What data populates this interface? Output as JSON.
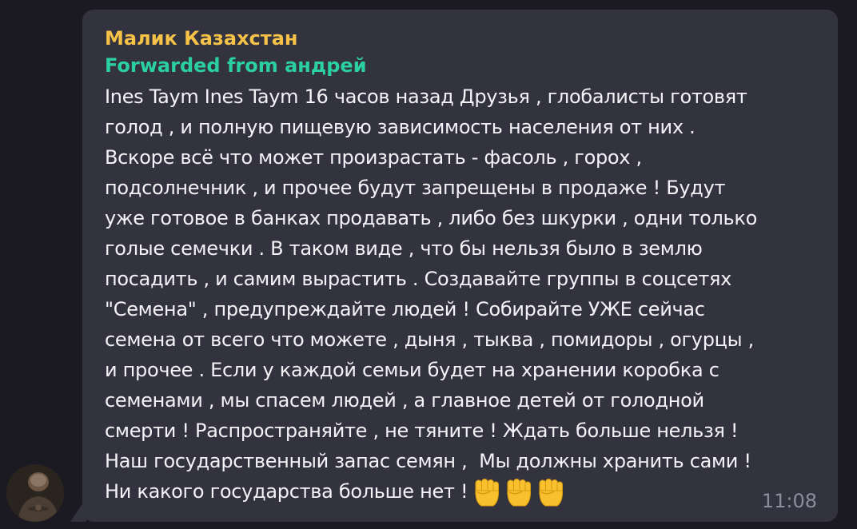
{
  "message": {
    "author": "Малик Казахстан",
    "forwarded": "Forwarded from андрей",
    "lines": [
      "Ines Taym Ines Taym 16 часов назад Друзья , глобалисты готовят",
      "голод , и полную пищевую зависимость населения от них .",
      "Вскоре всё что может произрастать - фасоль , горох ,",
      "подсолнечник , и прочее будут запрещены в продаже ! Будут",
      "уже готовое в банках продавать , либо без шкурки , одни только",
      "голые семечки . В таком виде , что бы нельзя было в землю",
      "посадить , и самим вырастить . Создавайте группы в соцсетях",
      "\"Семена\" , предупреждайте людей ! Собирайте УЖЕ сейчас",
      "семена от всего что можете , дыня , тыква , помидоры , огурцы ,",
      "и прочее . Если у каждой семьи будет на хранении коробка с",
      "семенами , мы спасем людей , а главное детей от голодной",
      "смерти ! Распространяйте , не тяните ! Ждать больше нельзя !",
      "Наш государственный запас семян ,  Мы должны хранить сами !",
      "Ни какого государства больше нет !"
    ],
    "emoji": "✊",
    "emoji_count": 3,
    "time": "11:08"
  },
  "colors": {
    "background": "#1b1a23",
    "bubble": "#33323f",
    "author": "#f6c348",
    "forwarded": "#2bd0a2",
    "text": "#f3f3f7",
    "time": "#8d8c9a"
  },
  "icons": {
    "avatar": "user-avatar",
    "emoji": "raised-fist-icon"
  }
}
